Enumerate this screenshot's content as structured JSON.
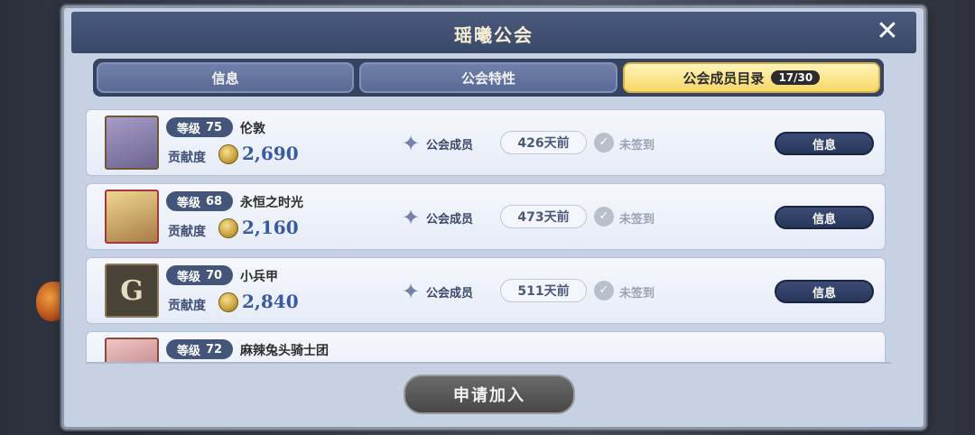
{
  "dialog": {
    "title": "瑶曦公会",
    "close_icon": "close-icon"
  },
  "tabs": [
    {
      "label": "信息"
    },
    {
      "label": "公会特性"
    },
    {
      "label": "公会成员目录",
      "badge": "17/30"
    }
  ],
  "members": [
    {
      "level_label": "等级",
      "level": "75",
      "name": "伦敦",
      "contrib_label": "贡献度",
      "contrib": "2,690",
      "rank": "公会成员",
      "last_seen": "426天前",
      "signin": "未签到",
      "info_button": "信息",
      "avatar_text": ""
    },
    {
      "level_label": "等级",
      "level": "68",
      "name": "永恒之时光",
      "contrib_label": "贡献度",
      "contrib": "2,160",
      "rank": "公会成员",
      "last_seen": "473天前",
      "signin": "未签到",
      "info_button": "信息",
      "avatar_text": ""
    },
    {
      "level_label": "等级",
      "level": "70",
      "name": "小兵甲",
      "contrib_label": "贡献度",
      "contrib": "2,840",
      "rank": "公会成员",
      "last_seen": "511天前",
      "signin": "未签到",
      "info_button": "信息",
      "avatar_text": "G"
    },
    {
      "level_label": "等级",
      "level": "72",
      "name": "麻辣兔头骑士团",
      "contrib_label": "",
      "contrib": "",
      "rank": "",
      "last_seen": "",
      "signin": "",
      "info_button": "",
      "avatar_text": ""
    }
  ],
  "footer": {
    "apply_button": "申请加入"
  }
}
